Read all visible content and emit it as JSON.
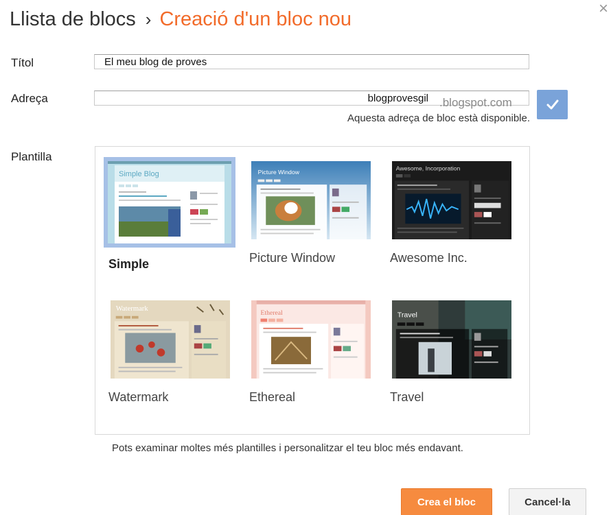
{
  "header": {
    "breadcrumb_root": "Llista de blocs",
    "breadcrumb_separator": "›",
    "breadcrumb_current": "Creació d'un bloc nou",
    "close_symbol": "×",
    "accent_color": "#f26b2a"
  },
  "form": {
    "title_label": "Títol",
    "title_value": "El meu blog de proves",
    "address_label": "Adreça",
    "address_value": "blogprovesgil",
    "address_suffix": ".blogspot.com",
    "availability_message": "Aquesta adreça de bloc està disponible.",
    "check_icon": "check-icon",
    "template_label": "Plantilla"
  },
  "templates": [
    {
      "name": "Simple",
      "selected": true
    },
    {
      "name": "Picture Window",
      "selected": false
    },
    {
      "name": "Awesome Inc.",
      "selected": false
    },
    {
      "name": "Watermark",
      "selected": false
    },
    {
      "name": "Ethereal",
      "selected": false
    },
    {
      "name": "Travel",
      "selected": false
    }
  ],
  "hint": "Pots examinar moltes més plantilles i personalitzar el teu bloc més endavant.",
  "buttons": {
    "create_label": "Crea el bloc",
    "cancel_label": "Cancel·la",
    "create_color": "#f68b3f"
  }
}
